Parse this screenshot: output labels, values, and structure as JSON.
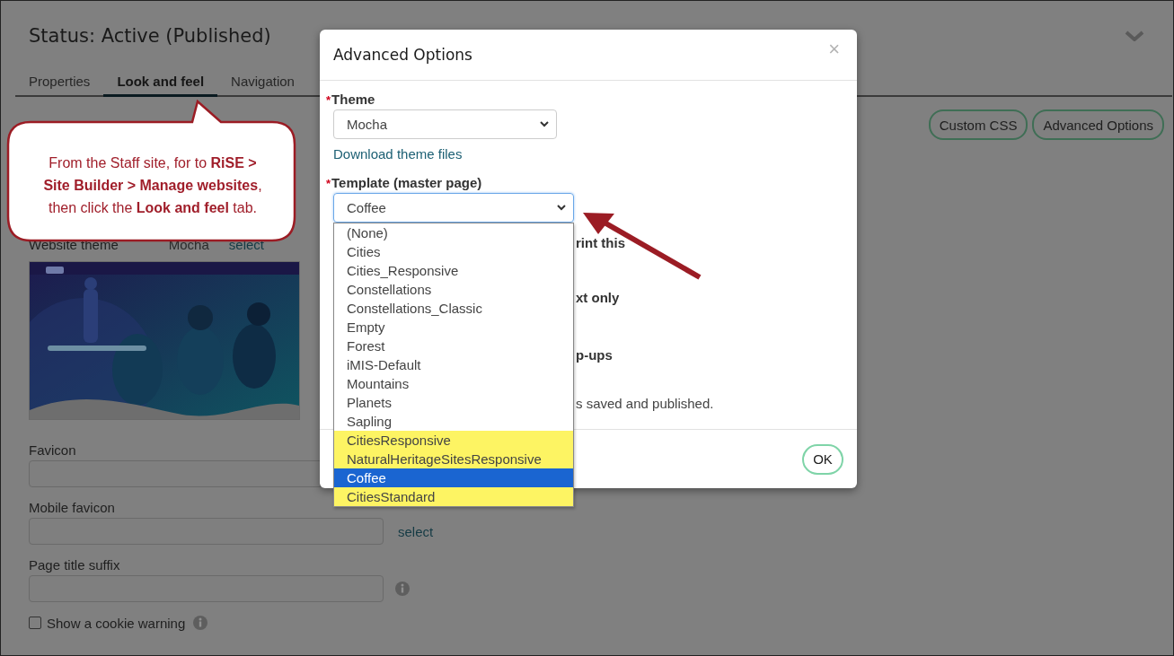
{
  "page": {
    "title": "Status: Active (Published)",
    "tabs": [
      {
        "label": "Properties",
        "selected": false
      },
      {
        "label": "Look and feel",
        "selected": true
      },
      {
        "label": "Navigation",
        "selected": false
      }
    ],
    "buttons": [
      "Custom CSS",
      "Advanced Options"
    ],
    "website_theme": {
      "label": "Website theme",
      "value": "Mocha",
      "link": "select"
    },
    "fields": [
      {
        "label": "Favicon"
      },
      {
        "label": "Mobile favicon",
        "link": "select"
      },
      {
        "label": "Page title suffix",
        "info": true
      }
    ],
    "cookie_warning": {
      "label": "Show a cookie warning",
      "checked": false,
      "info": true
    }
  },
  "callout": {
    "text": "From the Staff site, for to **RiSE >** **Site Builder > Manage websites**, then click the **Look and feel** tab."
  },
  "dialog": {
    "title": "Advanced Options",
    "close": "×",
    "theme": {
      "label": "Theme",
      "required_mark": "*",
      "value": "Mocha"
    },
    "download_link": "Download theme files",
    "template": {
      "label": "Template (master page)",
      "required_mark": "*",
      "value": "Coffee",
      "expanded": true,
      "options": [
        {
          "label": "(None)",
          "highlighted": false,
          "selected": false
        },
        {
          "label": "Cities",
          "highlighted": false,
          "selected": false
        },
        {
          "label": "Cities_Responsive",
          "highlighted": false,
          "selected": false
        },
        {
          "label": "Constellations",
          "highlighted": false,
          "selected": false
        },
        {
          "label": "Constellations_Classic",
          "highlighted": false,
          "selected": false
        },
        {
          "label": "Empty",
          "highlighted": false,
          "selected": false
        },
        {
          "label": "Forest",
          "highlighted": false,
          "selected": false
        },
        {
          "label": "iMIS-Default",
          "highlighted": false,
          "selected": false
        },
        {
          "label": "Mountains",
          "highlighted": false,
          "selected": false
        },
        {
          "label": "Planets",
          "highlighted": false,
          "selected": false
        },
        {
          "label": "Sapling",
          "highlighted": false,
          "selected": false
        },
        {
          "label": "CitiesResponsive",
          "highlighted": true,
          "selected": false
        },
        {
          "label": "NaturalHeritageSitesResponsive",
          "highlighted": true,
          "selected": false
        },
        {
          "label": "Coffee",
          "highlighted": true,
          "selected": true
        },
        {
          "label": "CitiesStandard",
          "highlighted": true,
          "selected": false
        }
      ]
    },
    "partial_texts": [
      {
        "text": "rint this",
        "kind": "bold"
      },
      {
        "text": "xt only",
        "kind": "bold"
      },
      {
        "text": "p-ups",
        "kind": "bold"
      },
      {
        "text": "s saved and published.",
        "kind": "plain"
      }
    ],
    "ok": "OK"
  }
}
